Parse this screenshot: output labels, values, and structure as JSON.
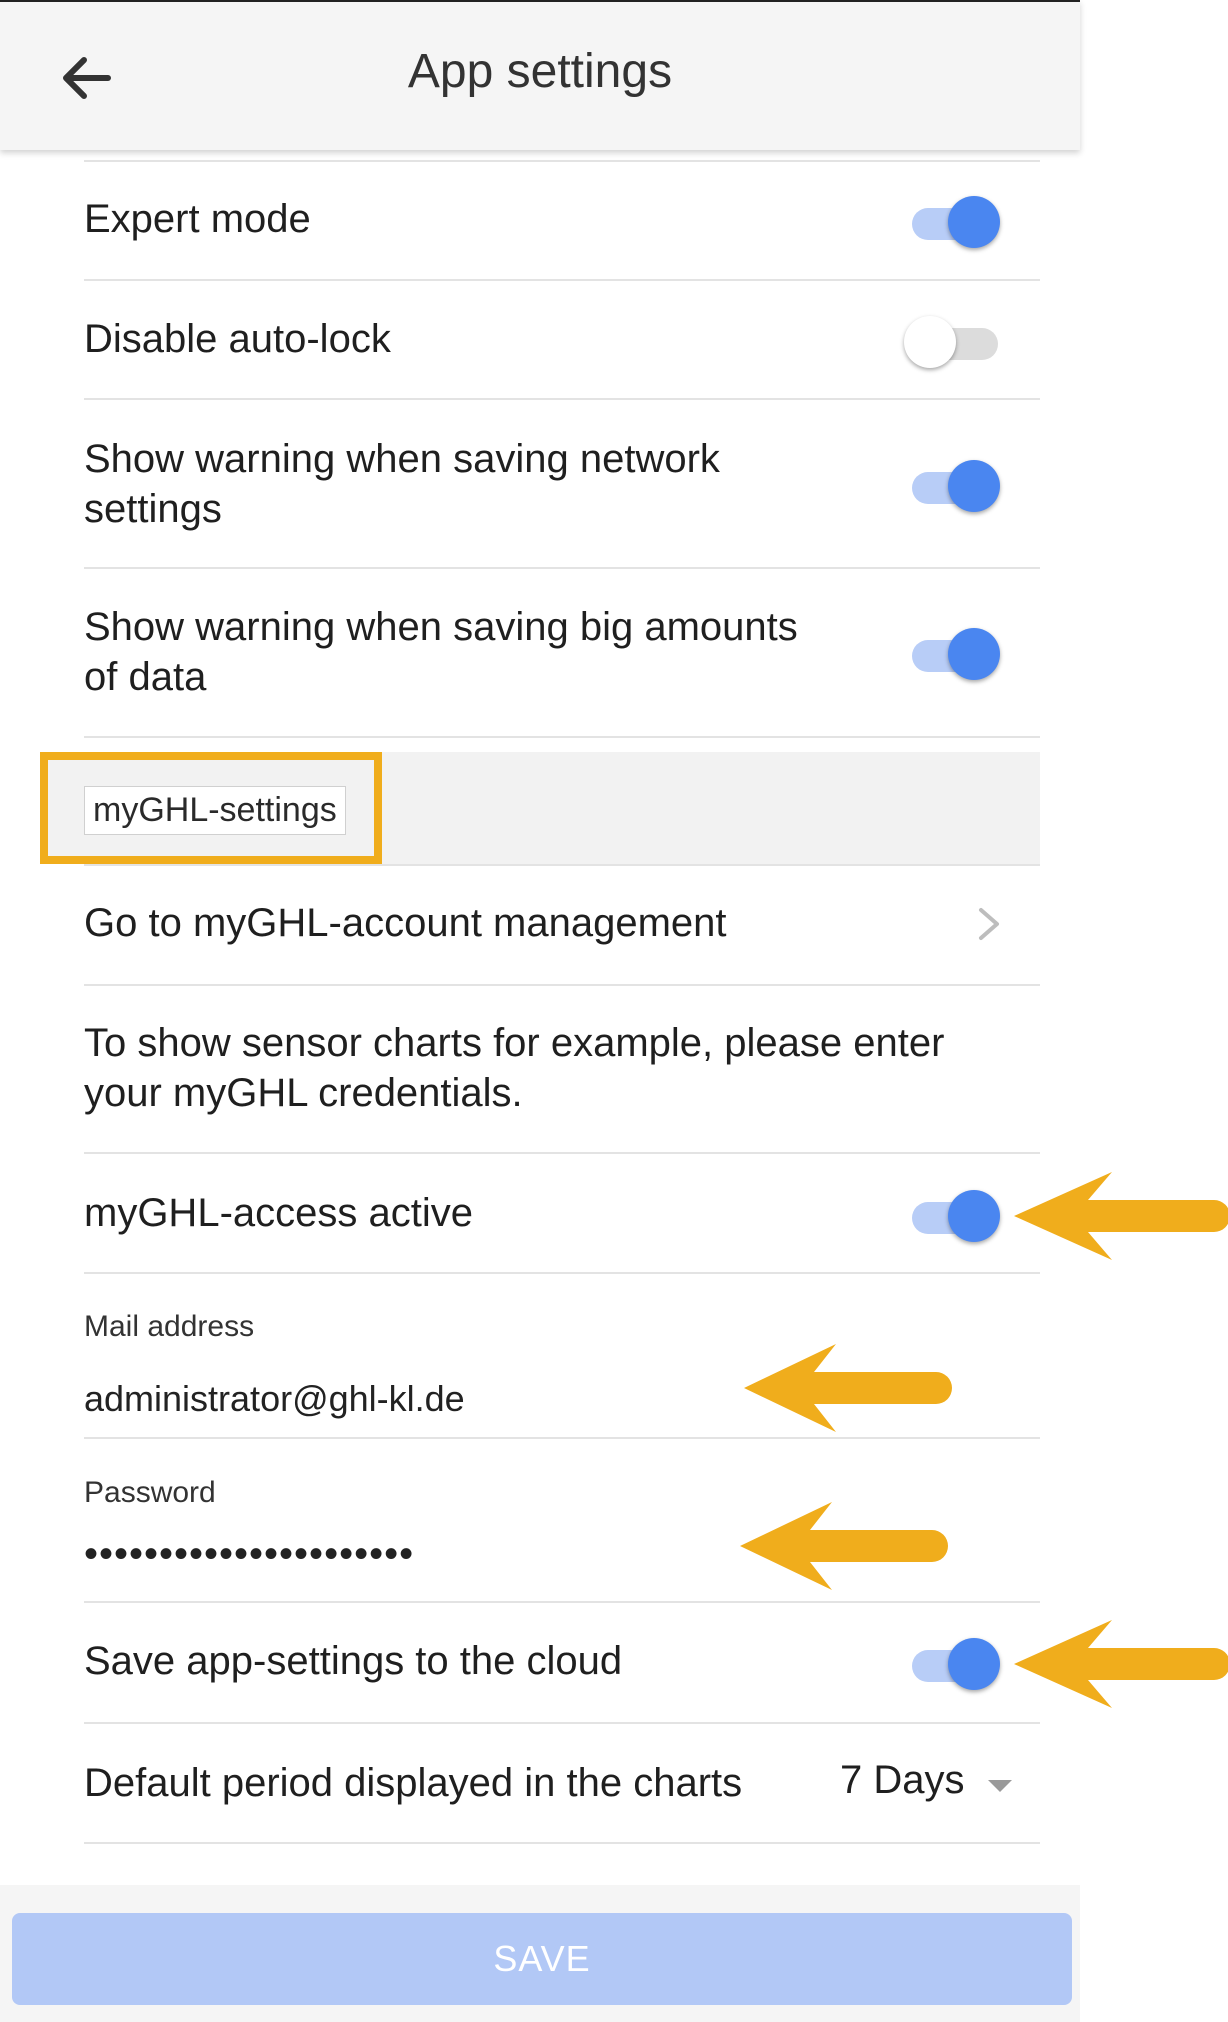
{
  "appbar": {
    "title": "App settings",
    "back_icon": "arrow-left-icon"
  },
  "settings": {
    "expert_mode": {
      "label": "Expert mode",
      "enabled": true
    },
    "disable_autolock": {
      "label": "Disable auto-lock",
      "enabled": false
    },
    "warn_network": {
      "label_line1": "Show warning when saving network",
      "label_line2": "settings",
      "enabled": true
    },
    "warn_big_data": {
      "label_line1": "Show warning when saving big amounts",
      "label_line2": "of data",
      "enabled": true
    }
  },
  "section": {
    "title": "myGHL-settings"
  },
  "myghl": {
    "account_management": {
      "label": "Go to myGHL-account management"
    },
    "info_line1": "To show sensor charts for example, please enter",
    "info_line2": "your myGHL credentials.",
    "access_active": {
      "label": "myGHL-access active",
      "enabled": true
    },
    "mail": {
      "label": "Mail address",
      "value": "administrator@ghl-kl.de"
    },
    "password": {
      "label": "Password",
      "value": "••••••••••••••••••••••"
    },
    "save_cloud": {
      "label": "Save app-settings to the cloud",
      "enabled": true
    },
    "default_period": {
      "label": "Default period displayed in the charts",
      "value": "7 Days"
    }
  },
  "footer": {
    "save_label": "SAVE"
  },
  "colors": {
    "accent": "#4a86f0",
    "accent_track": "#b8cdf7",
    "highlight": "#f0ad1c",
    "save_disabled": "#b2c8f6"
  }
}
